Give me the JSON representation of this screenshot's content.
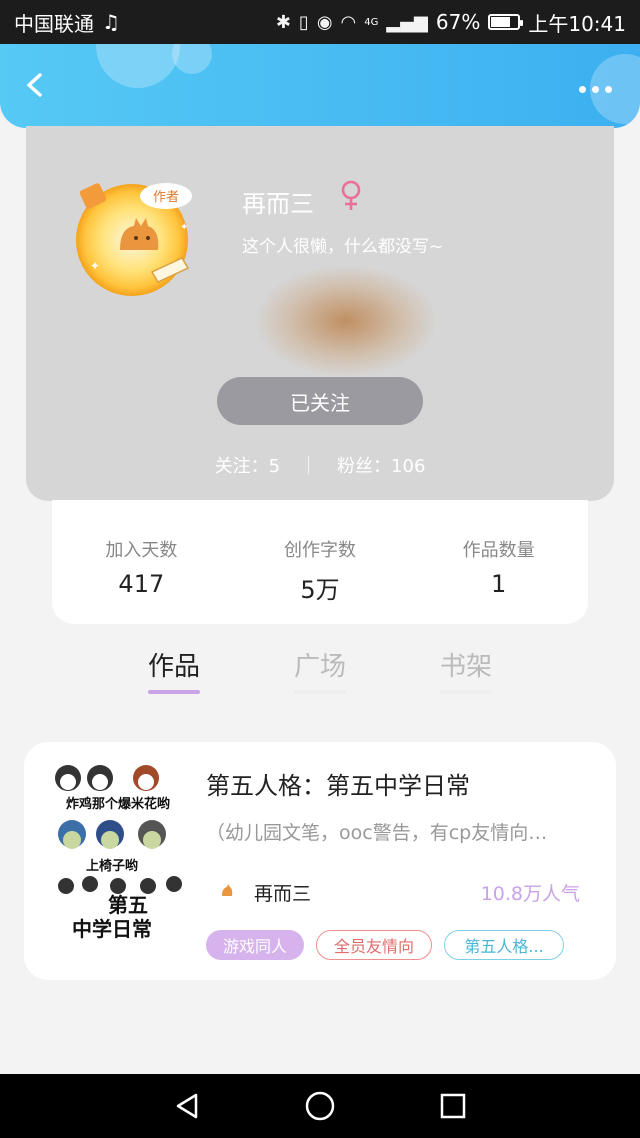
{
  "status_bar": {
    "carrier": "中国联通",
    "signal_label": "4G",
    "battery": "67%",
    "time": "上午10:41"
  },
  "profile": {
    "name": "再而三",
    "bio": "这个人很懒，什么都没写~",
    "avatar_badge": "作者",
    "follow_button": "已关注",
    "following_label": "关注：",
    "following_count": "5",
    "followers_label": "粉丝：",
    "followers_count": "106"
  },
  "stats": [
    {
      "label": "加入天数",
      "value": "417"
    },
    {
      "label": "创作字数",
      "value": "5万"
    },
    {
      "label": "作品数量",
      "value": "1"
    }
  ],
  "tabs": [
    {
      "label": "作品",
      "active": true
    },
    {
      "label": "广场",
      "active": false
    },
    {
      "label": "书架",
      "active": false
    }
  ],
  "work": {
    "title": "第五人格：第五中学日常",
    "description": "（幼儿园文笔，ooc警告，有cp友情向…",
    "author": "再而三",
    "popularity": "10.8万人气",
    "tags": [
      "游戏同人",
      "全员友情向",
      "第五人格..."
    ],
    "cover": {
      "line1": "炸鸡那个爆米花哟",
      "line2": "上椅子哟",
      "line3": "第五",
      "line4": "中学日常"
    }
  },
  "colors": {
    "header": "#3cb0f0",
    "accent_purple": "#c9a3e8",
    "tag_red": "#e06c6c",
    "tag_blue": "#4ab6d6"
  }
}
